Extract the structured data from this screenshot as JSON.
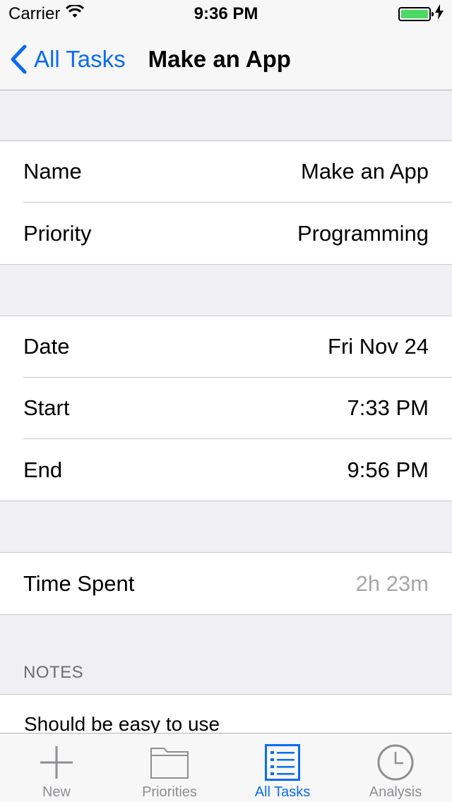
{
  "status": {
    "carrier": "Carrier",
    "time": "9:36 PM",
    "battery_color": "#4cd964"
  },
  "nav": {
    "back_label": "All Tasks",
    "title": "Make an App"
  },
  "task": {
    "name_label": "Name",
    "name_value": "Make an App",
    "priority_label": "Priority",
    "priority_value": "Programming",
    "date_label": "Date",
    "date_value": "Fri Nov 24",
    "start_label": "Start",
    "start_value": "7:33 PM",
    "end_label": "End",
    "end_value": "9:56 PM",
    "time_spent_label": "Time Spent",
    "time_spent_value": "2h 23m"
  },
  "notes": {
    "header": "NOTES",
    "text": "Should be easy to use"
  },
  "tabs": [
    {
      "label": "New",
      "icon": "plus-icon"
    },
    {
      "label": "Priorities",
      "icon": "folder-icon"
    },
    {
      "label": "All Tasks",
      "icon": "list-icon"
    },
    {
      "label": "Analysis",
      "icon": "clock-icon"
    }
  ],
  "colors": {
    "accent": "#0a6cf0",
    "inactive": "#8e8e93"
  }
}
